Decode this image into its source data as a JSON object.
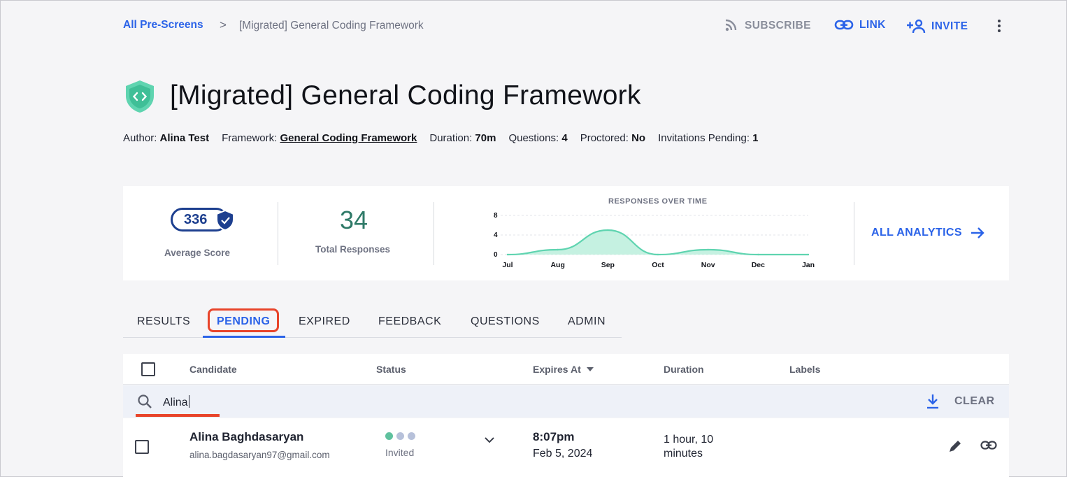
{
  "breadcrumb": {
    "root": "All Pre-Screens",
    "separator": ">",
    "current": "[Migrated] General Coding Framework"
  },
  "actions": {
    "subscribe": "SUBSCRIBE",
    "link": "LINK",
    "invite": "INVITE"
  },
  "title": "[Migrated] General Coding Framework",
  "meta": {
    "author_label": "Author:",
    "author": "Alina Test",
    "framework_label": "Framework:",
    "framework": "General Coding Framework",
    "duration_label": "Duration:",
    "duration": "70m",
    "questions_label": "Questions:",
    "questions": "4",
    "proctored_label": "Proctored:",
    "proctored": "No",
    "pending_label": "Invitations Pending:",
    "pending": "1"
  },
  "stats": {
    "average_score": "336",
    "average_score_label": "Average Score",
    "total_responses": "34",
    "total_responses_label": "Total Responses",
    "all_analytics": "ALL ANALYTICS"
  },
  "chart_data": {
    "type": "area",
    "title": "RESPONSES OVER TIME",
    "categories": [
      "Jul",
      "Aug",
      "Sep",
      "Oct",
      "Nov",
      "Dec",
      "Jan"
    ],
    "values": [
      0,
      1,
      5,
      0,
      1,
      0,
      0
    ],
    "yticks": [
      0,
      4,
      8
    ],
    "ylim": [
      0,
      8
    ],
    "xlabel": "",
    "ylabel": "",
    "color": "#5fd4b0"
  },
  "tabs": [
    {
      "label": "RESULTS",
      "active": false
    },
    {
      "label": "PENDING",
      "active": true
    },
    {
      "label": "EXPIRED",
      "active": false
    },
    {
      "label": "FEEDBACK",
      "active": false
    },
    {
      "label": "QUESTIONS",
      "active": false
    },
    {
      "label": "ADMIN",
      "active": false
    }
  ],
  "table": {
    "columns": [
      "Candidate",
      "Status",
      "Expires At",
      "Duration",
      "Labels"
    ],
    "search_value": "Alina",
    "clear_label": "CLEAR",
    "rows": [
      {
        "name": "Alina Baghdasaryan",
        "email": "alina.bagdasaryan97@gmail.com",
        "status": "Invited",
        "expires_time": "8:07pm",
        "expires_date": "Feb 5, 2024",
        "duration": "1 hour, 10 minutes",
        "labels": ""
      }
    ]
  },
  "colors": {
    "accent": "#2b63e8",
    "highlight": "#e8442a",
    "teal": "#5fd4b0",
    "navy": "#1d3f8f"
  }
}
